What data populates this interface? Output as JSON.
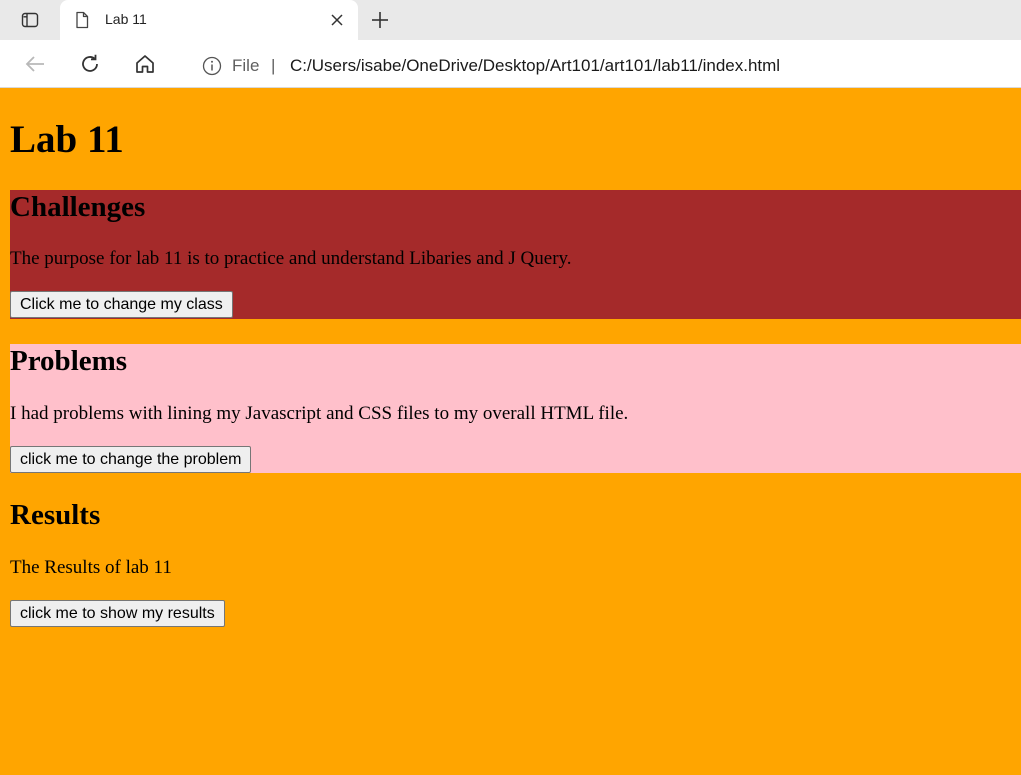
{
  "browser": {
    "tab": {
      "title": "Lab 11"
    },
    "address": {
      "scheme_label": "File",
      "separator": "|",
      "url": "C:/Users/isabe/OneDrive/Desktop/Art101/art101/lab11/index.html"
    },
    "icons": [
      "sidebar-toggle-icon",
      "page-icon",
      "close-icon",
      "plus-icon",
      "back-arrow-icon",
      "refresh-icon",
      "home-icon",
      "info-icon"
    ]
  },
  "page": {
    "title": "Lab 11",
    "background": "#ffa500",
    "challenges": {
      "heading": "Challenges",
      "text": "The purpose for lab 11 is to practice and understand Libaries and J Query.",
      "button": "Click me to change my class",
      "background": "#a52a2a"
    },
    "problems": {
      "heading": "Problems",
      "text": "I had problems with lining my Javascript and CSS files to my overall HTML file.",
      "button": "click me to change the problem",
      "background": "#ffc0cb"
    },
    "results": {
      "heading": "Results",
      "text": "The Results of lab 11",
      "button": "click me to show my results"
    }
  }
}
